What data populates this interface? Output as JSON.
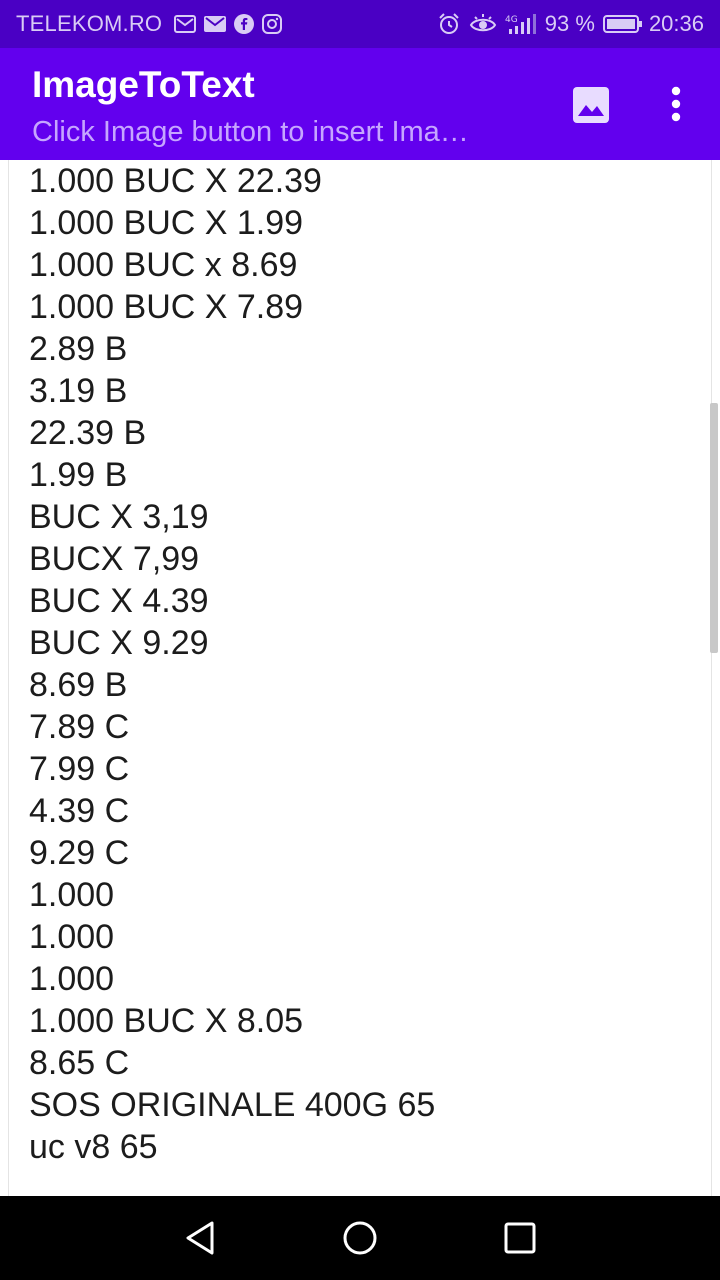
{
  "status_bar": {
    "carrier": "TELEKOM.RO",
    "left_icons": [
      "gallery-mail-icon",
      "mail-icon",
      "facebook-icon",
      "instagram-icon"
    ],
    "right_icons": [
      "alarm-icon",
      "eye-comfort-icon",
      "signal-4g-icon",
      "battery-icon"
    ],
    "battery": "93 %",
    "time": "20:36"
  },
  "app_bar": {
    "title": "ImageToText",
    "subtitle": "Click Image button  to insert Ima…",
    "image_button_icon": "image-icon",
    "overflow_icon": "more-vert-icon",
    "color": "#6200ee"
  },
  "content": {
    "lines": [
      "1.000 BUC X 22.39",
      "1.000 BUC X 1.99",
      "1.000 BUC x 8.69",
      "1.000 BUC X 7.89",
      "2.89 B",
      "3.19 B",
      "22.39 B",
      "1.99 B",
      "BUC X 3,19",
      "BUCX 7,99",
      "BUC X 4.39",
      "BUC X 9.29",
      "8.69 B",
      "7.89 C",
      "7.99 C",
      "4.39 C",
      "9.29 C",
      "1.000",
      "1.000",
      "1.000",
      "1.000 BUC X 8.05",
      "8.65 C",
      "SOS ORIGINALE 400G 65",
      "uc v8 65"
    ]
  },
  "nav_bar": {
    "icons": [
      "back-icon",
      "home-icon",
      "recents-icon"
    ]
  }
}
